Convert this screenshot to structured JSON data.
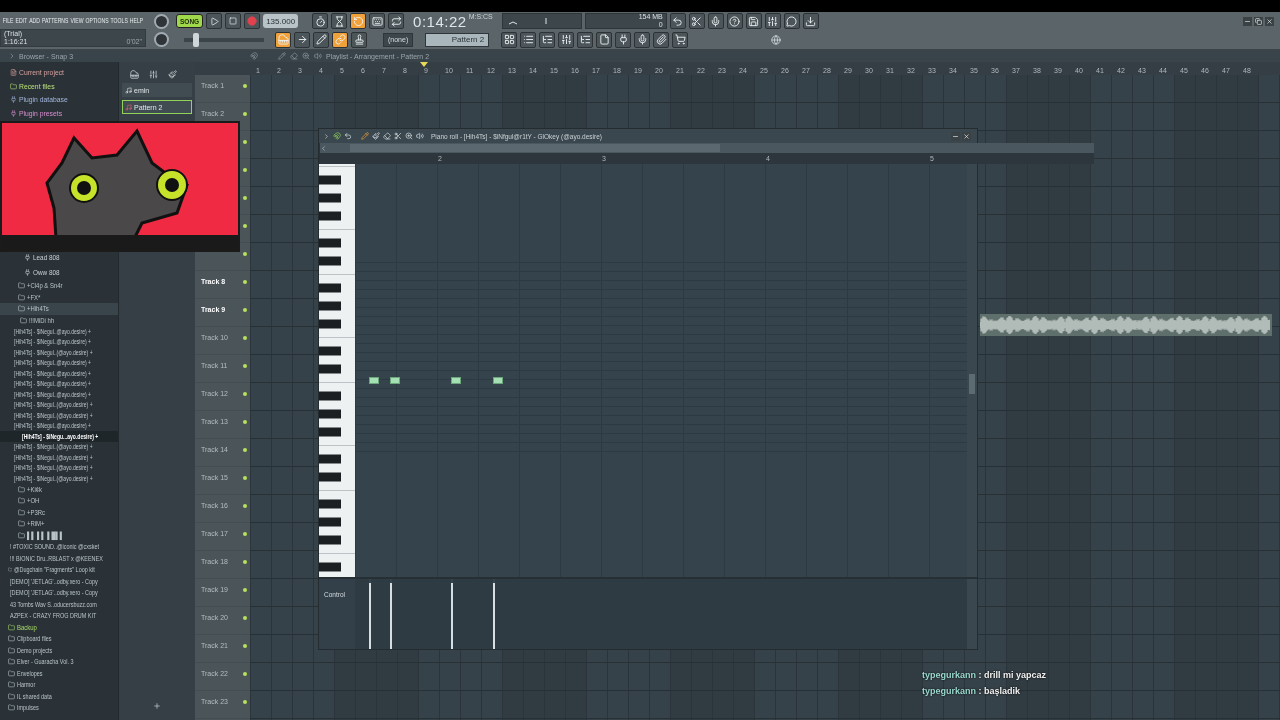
{
  "menu": [
    "FILE",
    "EDIT",
    "ADD",
    "PATTERNS",
    "VIEW",
    "OPTIONS",
    "TOOLS",
    "HELP"
  ],
  "hint_panel": {
    "line_1": "(Trial)",
    "line_2": "1:16:21",
    "reading": "0'02\""
  },
  "transport": {
    "song_mode": {
      "label": "SONG",
      "on": true
    },
    "tempo": "135.000",
    "time": "0:14:22",
    "time_format": "M:S:CS",
    "memory": "154 MB",
    "polyphony": "0"
  },
  "toolbar_left": [
    {
      "kind": "metronome",
      "on": false
    },
    {
      "kind": "wait",
      "on": false
    },
    {
      "kind": "countdown",
      "on": true
    },
    {
      "kind": "keyboard",
      "on": false
    },
    {
      "kind": "loop",
      "on": false
    }
  ],
  "toolbar_right": [
    {
      "kind": "undo",
      "on": false
    },
    {
      "kind": "cut",
      "on": false
    },
    {
      "kind": "mic",
      "on": false
    },
    {
      "kind": "help",
      "on": false
    },
    {
      "kind": "save",
      "on": false
    },
    {
      "kind": "render",
      "on": false
    },
    {
      "kind": "chat",
      "on": false
    },
    {
      "kind": "download",
      "on": false
    }
  ],
  "toolbar_row_2": [
    {
      "kind": "piano",
      "on": true
    },
    {
      "kind": "arrow",
      "on": false
    },
    {
      "kind": "pencil",
      "on": false
    },
    {
      "kind": "link",
      "on": true
    },
    {
      "kind": "stamp",
      "on": false
    }
  ],
  "master_pitch": {
    "level": 0.15
  },
  "pattern_selector": {
    "channel_filter": "(none)",
    "pattern": "Pattern 2"
  },
  "toolbar_windows": [
    {
      "kind": "playlist",
      "on": false
    },
    {
      "kind": "channels",
      "on": false
    },
    {
      "kind": "list",
      "on": false
    },
    {
      "kind": "mixer",
      "on": false
    },
    {
      "kind": "tree",
      "on": false
    },
    {
      "kind": "file",
      "on": false
    },
    {
      "kind": "plugin",
      "on": false
    },
    {
      "kind": "mic",
      "on": false
    },
    {
      "kind": "clip",
      "on": false
    },
    {
      "kind": "cart",
      "on": false
    }
  ],
  "browser": {
    "title": "Browser - Snap 3",
    "pinned": [
      {
        "label": "Current project",
        "kind": "project",
        "selected": false
      },
      {
        "label": "Recent files",
        "kind": "recent",
        "selected": false
      },
      {
        "label": "Plugin database",
        "kind": "plugin-db",
        "selected": false
      },
      {
        "label": "Plugin presets",
        "kind": "plugin-presets",
        "selected": false
      }
    ],
    "tree": [
      {
        "label": "Lead 808",
        "kind": "instrument",
        "selected": false
      },
      {
        "label": "Oww 808",
        "kind": "instrument",
        "selected": false
      },
      {
        "label": "+Cl4p & Sn4r",
        "kind": "subfolder",
        "selected": false,
        "expanded": false
      },
      {
        "label": "+FX*",
        "kind": "subfolder",
        "selected": false,
        "expanded": false
      },
      {
        "label": "+Hih4Ts",
        "kind": "subfolder",
        "selected": false,
        "expanded": true,
        "children": [
          {
            "label": "!!!MiDi hh",
            "kind": "subfolder",
            "selected": false,
            "expanded": false
          },
          {
            "label": "[Hih4Ts] - $iNegul..@ayo.desire) +",
            "kind": "file",
            "selected": false
          },
          {
            "label": "[Hih4Ts] - $iNegul..@ayo.desire) +",
            "kind": "file",
            "selected": false
          },
          {
            "label": "[Hih4Ts] - $iNegul..(@ayo.desire) +",
            "kind": "file",
            "selected": false
          },
          {
            "label": "[Hih4Ts] - $iNegul..@ayo.desire) +",
            "kind": "file",
            "selected": false
          },
          {
            "label": "[Hih4Ts] - $iNegul..@ayo.desire) +",
            "kind": "file",
            "selected": false
          },
          {
            "label": "[Hih4Ts] - $iNegul..@ayo.desire) +",
            "kind": "file",
            "selected": false
          },
          {
            "label": "[Hih4Ts] - $iNegul..@ayo.desire) +",
            "kind": "file",
            "selected": false
          },
          {
            "label": "[Hih4Ts] - $iNegul..(@ayo.desire) +",
            "kind": "file",
            "selected": false
          },
          {
            "label": "[Hih4Ts] - $iNegul..(@ayo.desire) +",
            "kind": "file",
            "selected": false
          },
          {
            "label": "[Hih4Ts] - $iNegul..@ayo.desire) +",
            "kind": "file",
            "selected": false
          },
          {
            "label": "[Hih4Ts] - $iNegu...ayo.desire) +",
            "kind": "file",
            "selected": true
          },
          {
            "label": "[Hih4Ts] - $iNegul..(@ayo.desire) +",
            "kind": "file",
            "selected": false
          },
          {
            "label": "[Hih4Ts] - $iNegul..(@ayo.desire) +",
            "kind": "file",
            "selected": false
          },
          {
            "label": "[Hih4Ts] - $iNegul..(@ayo.desire) +",
            "kind": "file",
            "selected": false
          },
          {
            "label": "[Hih4Ts] - $iNegul..(@ayo.desire) +",
            "kind": "file",
            "selected": false
          }
        ]
      },
      {
        "label": "+Ki¢k",
        "kind": "subfolder",
        "selected": false,
        "expanded": false
      },
      {
        "label": "+OH",
        "kind": "subfolder",
        "selected": false,
        "expanded": false
      },
      {
        "label": "+P3Rc",
        "kind": "subfolder",
        "selected": false,
        "expanded": false
      },
      {
        "label": "+RiM+",
        "kind": "subfolder",
        "selected": false,
        "expanded": false
      },
      {
        "label": "▌▌ ▌▌ ▌█▌▌",
        "kind": "subfolder",
        "selected": false,
        "expanded": false
      },
      {
        "label": "! #TOXIC SOUND..@iconic @cxsket",
        "kind": "folder",
        "selected": false,
        "expanded": false
      },
      {
        "label": "!!! BIONIC Dru..RBLAST x @KEENEX",
        "kind": "folder",
        "selected": false,
        "expanded": false
      },
      {
        "label": "@Dugchain \"Fragments\" Loop kit",
        "kind": "folder",
        "selected": false,
        "expanded": false
      },
      {
        "label": "[DEMO] 'JETLAG'..odby.xero - Copy",
        "kind": "folder",
        "selected": false,
        "expanded": false
      },
      {
        "label": "[DEMO] 'JETLAG'..odby.xero - Copy",
        "kind": "folder",
        "selected": false,
        "expanded": false
      },
      {
        "label": "43 Tombs Wav S..oducersbuzz.com",
        "kind": "folder",
        "selected": false,
        "expanded": false
      },
      {
        "label": "AZPEX - CRAZY FROG DRUM KIT",
        "kind": "folder",
        "selected": false,
        "expanded": false
      },
      {
        "label": "Backup",
        "kind": "backup",
        "selected": false,
        "expanded": false
      },
      {
        "label": "Clipboard files",
        "kind": "folder",
        "selected": false,
        "expanded": false
      },
      {
        "label": "Demo projects",
        "kind": "folder",
        "selected": false,
        "expanded": false
      },
      {
        "label": "Elver - Guaracha Vol. 3",
        "kind": "folder",
        "selected": false,
        "expanded": false
      },
      {
        "label": "Envelopes",
        "kind": "folder",
        "selected": false,
        "expanded": false
      },
      {
        "label": "Harmor",
        "kind": "folder",
        "selected": false,
        "expanded": false
      },
      {
        "label": "IL shared data",
        "kind": "folder",
        "selected": false,
        "expanded": false
      },
      {
        "label": "Impulses",
        "kind": "folder",
        "selected": false,
        "expanded": false
      }
    ]
  },
  "patterns": [
    {
      "label": "emin",
      "selected": false
    },
    {
      "label": "Pattern 2",
      "selected": true
    }
  ],
  "playlist": {
    "title": "Playlist - Arrangement - Pattern 2",
    "ruler": [
      "1",
      "2",
      "3",
      "4",
      "5",
      "6",
      "7",
      "8",
      "9",
      "10",
      "11",
      "12",
      "13",
      "14",
      "15",
      "16",
      "17",
      "18",
      "19",
      "20",
      "21",
      "22",
      "23",
      "24",
      "25",
      "26",
      "27",
      "28",
      "29",
      "30",
      "31",
      "32",
      "33",
      "34",
      "35",
      "36",
      "37",
      "38",
      "39",
      "40",
      "41",
      "42",
      "43",
      "44",
      "45",
      "46",
      "47",
      "48"
    ],
    "tracks_top": [
      {
        "label": "Track 1",
        "highlighted": false
      },
      {
        "label": "Track 2",
        "highlighted": false
      }
    ],
    "tracks_bottom": [
      {
        "label": "Track 8",
        "highlighted": true
      },
      {
        "label": "Track 9",
        "highlighted": true
      },
      {
        "label": "Track 10",
        "highlighted": false
      },
      {
        "label": "Track 11",
        "highlighted": false
      },
      {
        "label": "Track 12",
        "highlighted": false
      },
      {
        "label": "Track 13",
        "highlighted": false
      },
      {
        "label": "Track 14",
        "highlighted": false
      },
      {
        "label": "Track 15",
        "highlighted": false
      },
      {
        "label": "Track 16",
        "highlighted": false
      },
      {
        "label": "Track 17",
        "highlighted": false
      },
      {
        "label": "Track 18",
        "highlighted": false
      },
      {
        "label": "Track 19",
        "highlighted": false
      },
      {
        "label": "Track 20",
        "highlighted": false
      },
      {
        "label": "Track 21",
        "highlighted": false
      },
      {
        "label": "Track 22",
        "highlighted": false
      },
      {
        "label": "Track 23",
        "highlighted": false
      }
    ]
  },
  "piano_roll": {
    "title": "Piano roll - [Hih4Ts] - $iNfgul@r1tY - GlOkey (@ayo.desire)",
    "ruler": [
      "2",
      "3",
      "4",
      "5"
    ],
    "event_label": "Control",
    "notes": [
      {
        "level": 0.95
      },
      {
        "level": 0.95
      },
      {
        "level": 0.95
      },
      {
        "level": 0.95
      }
    ]
  },
  "chat": [
    {
      "user": "typegurkann",
      "message": ": drill mi yapcaz"
    },
    {
      "user": "typegurkann",
      "message": ": başladik"
    }
  ]
}
